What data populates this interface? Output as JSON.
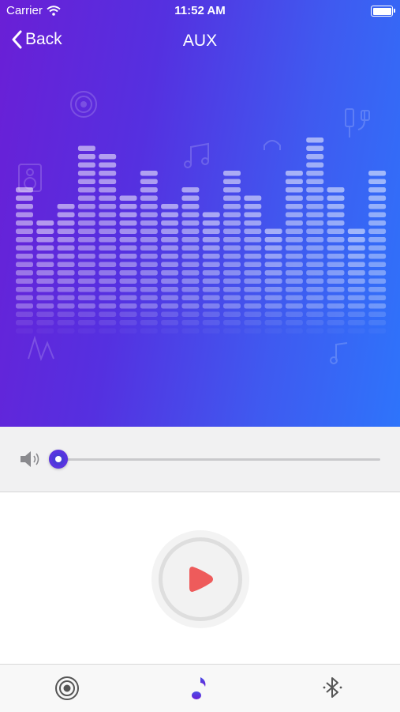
{
  "status_bar": {
    "carrier": "Carrier",
    "time": "11:52 AM"
  },
  "nav": {
    "back_label": "Back",
    "title": "AUX"
  },
  "equalizer_levels": [
    15,
    11,
    13,
    20,
    19,
    14,
    17,
    13,
    15,
    12,
    17,
    14,
    10,
    17,
    21,
    15,
    10,
    17
  ],
  "volume": {
    "level": 0.0
  },
  "tabs": [
    {
      "name": "radio",
      "icon": "radio-target-icon",
      "active": false
    },
    {
      "name": "music",
      "icon": "music-note-icon",
      "active": true
    },
    {
      "name": "bluetooth",
      "icon": "bluetooth-icon",
      "active": false
    }
  ],
  "colors": {
    "gradient_start": "#6a1fd6",
    "gradient_end": "#2e74fb",
    "accent": "#5a34e0",
    "play_red": "#ee5b5b"
  }
}
